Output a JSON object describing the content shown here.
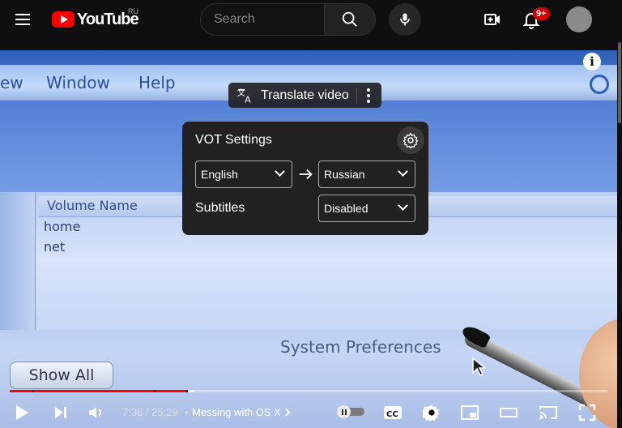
{
  "masthead": {
    "logo_text": "YouTube",
    "country_code": "RU",
    "search_placeholder": "Search",
    "notification_count": "9+"
  },
  "video_frame": {
    "menu_items": [
      "ew",
      "Window",
      "Help"
    ],
    "column_header": "Volume Name",
    "rows": [
      "home",
      "net"
    ],
    "window_title": "System Preferences",
    "show_all_button": "Show All"
  },
  "info_button": "i",
  "translate_button": {
    "label": "Translate video"
  },
  "vot_settings": {
    "title": "VOT Settings",
    "from_language": "English",
    "to_language": "Russian",
    "subtitles_label": "Subtitles",
    "subtitles_value": "Disabled"
  },
  "player": {
    "current_time": "7:36",
    "duration": "25:29",
    "time_display": "7:36 / 25:29",
    "separator": "•",
    "chapter_title": "Messing with OS X",
    "played_fraction": 0.298,
    "loaded_fraction": 0.31,
    "autoplay": "off",
    "colors": {
      "played": "#ff0000",
      "brand": "#ff0000",
      "badge": "#cc0000"
    }
  },
  "icons": {
    "menu": "hamburger-icon",
    "search": "search-icon",
    "mic": "mic-icon",
    "create": "create-icon",
    "notifications": "bell-icon",
    "play": "play-icon",
    "next": "next-icon",
    "volume": "volume-icon",
    "captions": "cc-icon",
    "settings": "gear-icon",
    "miniplayer": "miniplayer-icon",
    "theater": "theater-icon",
    "cast": "cast-icon",
    "fullscreen": "fullscreen-icon"
  }
}
